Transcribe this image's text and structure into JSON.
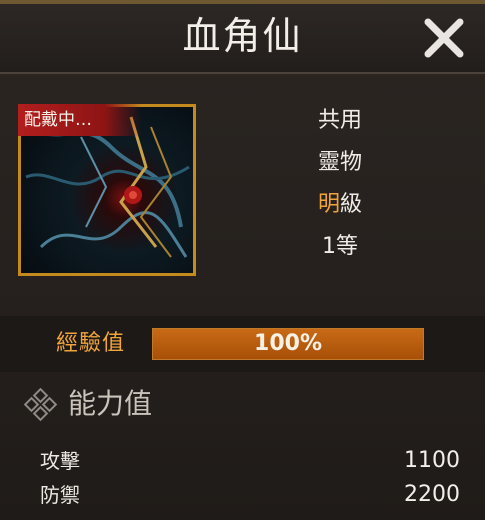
{
  "window": {
    "title": "血角仙"
  },
  "item": {
    "equipped_badge": "配戴中…",
    "info_lines": [
      "共用",
      "靈物"
    ],
    "grade": {
      "key": "明",
      "rest": "級"
    },
    "level": "1等"
  },
  "experience": {
    "label": "經驗值",
    "value_text": "100%",
    "fraction": 1.0
  },
  "stats": {
    "title": "能力值",
    "rows": [
      {
        "name": "攻擊",
        "value": "1100"
      },
      {
        "name": "防禦",
        "value": "2200"
      }
    ]
  },
  "colors": {
    "accent": "#f0a43a",
    "frame": "#c48a1e",
    "badge": "#b21e1e",
    "exp_fill": "#b85c0e"
  },
  "icons": {
    "close": "close-icon",
    "stats": "diamond-cluster-icon"
  }
}
